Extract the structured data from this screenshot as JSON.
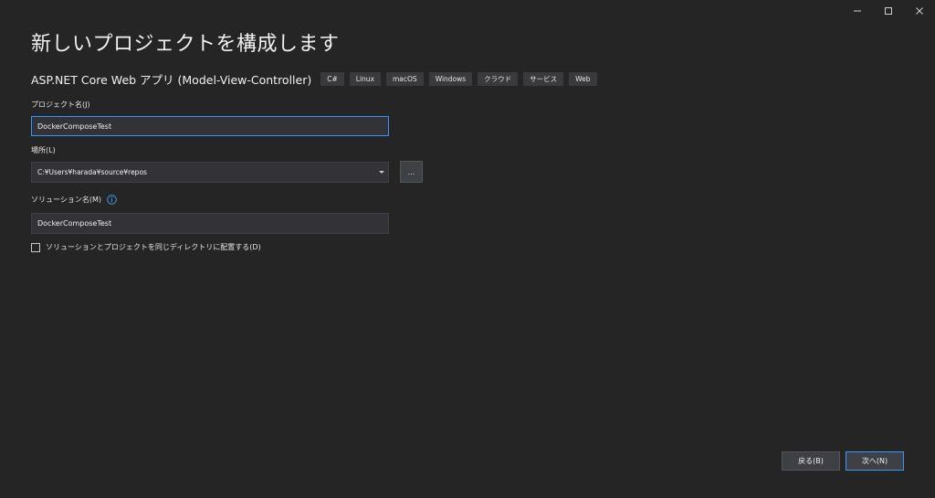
{
  "window": {
    "controls": {
      "minimize_icon": "minimize-icon",
      "maximize_icon": "maximize-icon",
      "close_icon": "close-icon"
    }
  },
  "page": {
    "title": "新しいプロジェクトを構成します"
  },
  "template": {
    "name": "ASP.NET Core Web アプリ (Model-View-Controller)",
    "tags": [
      "C#",
      "Linux",
      "macOS",
      "Windows",
      "クラウド",
      "サービス",
      "Web"
    ]
  },
  "fields": {
    "project_name": {
      "label": "プロジェクト名(J)",
      "value": "DockerComposeTest"
    },
    "location": {
      "label": "場所(L)",
      "value": "C:¥Users¥harada¥source¥repos",
      "browse_label": "..."
    },
    "solution_name": {
      "label": "ソリューション名(M)",
      "value": "DockerComposeTest",
      "info_icon": "info-icon"
    }
  },
  "options": {
    "same_directory": {
      "label": "ソリューションとプロジェクトを同じディレクトリに配置する(D)",
      "checked": false
    }
  },
  "footer": {
    "back_label": "戻る(B)",
    "next_label": "次へ(N)"
  },
  "colors": {
    "background": "#252526",
    "field_background": "#333337",
    "focus_accent": "#3399ff",
    "info_icon": "#3a96dd"
  }
}
